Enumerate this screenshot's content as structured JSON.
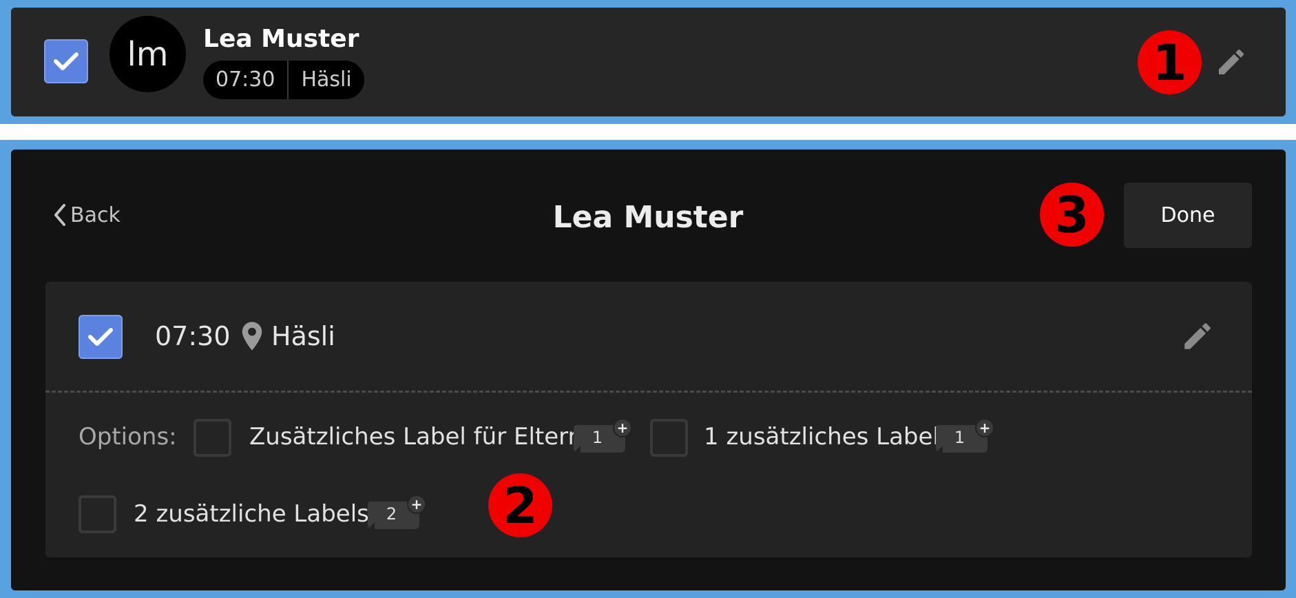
{
  "list_row": {
    "name": "Lea Muster",
    "avatar_initials": "lm",
    "time": "07:30",
    "location": "Häsli",
    "checked": true
  },
  "badges": {
    "one": "1",
    "two": "2",
    "three": "3"
  },
  "edit_panel": {
    "back_label": "Back",
    "title": "Lea Muster",
    "done_label": "Done",
    "slot": {
      "time": "07:30",
      "location": "Häsli",
      "checked": true
    },
    "options_label": "Options:",
    "options": [
      {
        "label": "Zusätzliches Label für Eltern",
        "count": "1",
        "checked": false
      },
      {
        "label": "1 zusätzliches Label",
        "count": "1",
        "checked": false
      },
      {
        "label": "2 zusätzliche Labels",
        "count": "2",
        "checked": false
      }
    ]
  },
  "colors": {
    "accent_checkbox": "#5b82de",
    "badge_red": "#f00000",
    "background_blue": "#5aa1e0",
    "panel_dark": "#131313",
    "card_dark": "#262626"
  },
  "icons": [
    "check-icon",
    "pencil-icon",
    "chevron-left-icon",
    "location-pin-icon",
    "label-tag-icon",
    "plus-icon"
  ]
}
